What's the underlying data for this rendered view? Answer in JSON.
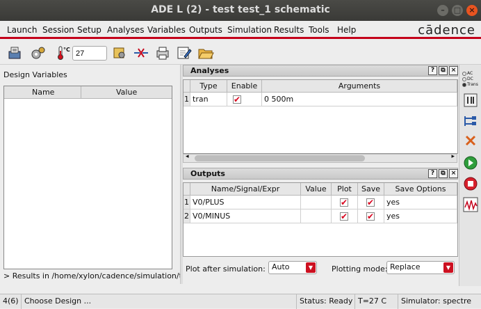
{
  "window": {
    "title": "ADE L (2) - test test_1 schematic",
    "controls": [
      "minimize",
      "maximize",
      "close"
    ]
  },
  "menubar": {
    "items": [
      "Launch",
      "Session",
      "Setup",
      "Analyses",
      "Variables",
      "Outputs",
      "Simulation",
      "Results",
      "Tools",
      "Help"
    ],
    "brand": "cādence"
  },
  "toolbar": {
    "temperature_unit": "°C",
    "temperature_value": "27"
  },
  "design_variables": {
    "label": "Design Variables",
    "columns": [
      "Name",
      "Value"
    ],
    "rows": []
  },
  "results_path": "> Results in /home/xylon/cadence/simulation/te",
  "analyses": {
    "title": "Analyses",
    "columns": [
      "Type",
      "Enable",
      "Arguments"
    ],
    "rows": [
      {
        "num": "1",
        "type": "tran",
        "enabled": true,
        "arguments": "0 500m"
      }
    ]
  },
  "outputs": {
    "title": "Outputs",
    "columns": [
      "Name/Signal/Expr",
      "Value",
      "Plot",
      "Save",
      "Save Options"
    ],
    "rows": [
      {
        "num": "1",
        "name": "V0/PLUS",
        "value": "",
        "plot": true,
        "save": true,
        "save_options": "yes"
      },
      {
        "num": "2",
        "name": "V0/MINUS",
        "value": "",
        "plot": true,
        "save": true,
        "save_options": "yes"
      }
    ]
  },
  "options": {
    "plot_after_label": "Plot after simulation:",
    "plot_after_value": "Auto",
    "plotting_mode_label": "Plotting mode:",
    "plotting_mode_value": "Replace"
  },
  "right_tools": {
    "radio_options": [
      "AC",
      "DC",
      "Trans"
    ]
  },
  "statusbar": {
    "count": "4(6)",
    "prompt": "Choose Design ...",
    "status": "Status: Ready",
    "temp": "T=27  C",
    "simulator": "Simulator: spectre"
  },
  "colors": {
    "accent_red": "#c4001a",
    "titlebar": "#3c3b37"
  }
}
